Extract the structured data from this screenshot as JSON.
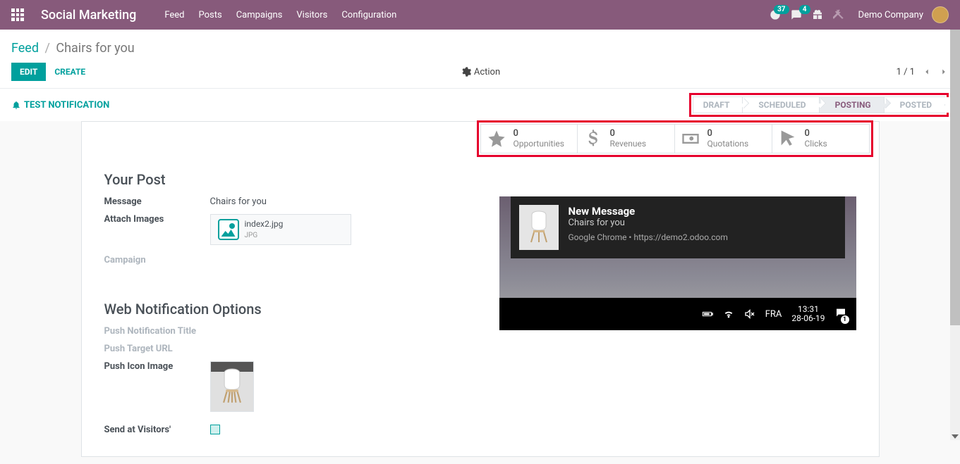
{
  "navbar": {
    "brand": "Social Marketing",
    "items": [
      "Feed",
      "Posts",
      "Campaigns",
      "Visitors",
      "Configuration"
    ],
    "clock_badge": "37",
    "chat_badge": "4",
    "company": "Demo Company"
  },
  "breadcrumb": {
    "parent": "Feed",
    "current": "Chairs for you"
  },
  "buttons": {
    "edit": "Edit",
    "create": "Create",
    "action": "Action",
    "test": "Test Notification"
  },
  "pager": {
    "value": "1 / 1"
  },
  "status": {
    "steps": [
      "Draft",
      "Scheduled",
      "Posting",
      "Posted"
    ],
    "active_index": 2
  },
  "stats": [
    {
      "value": "0",
      "label": "Opportunities"
    },
    {
      "value": "0",
      "label": "Revenues"
    },
    {
      "value": "0",
      "label": "Quotations"
    },
    {
      "value": "0",
      "label": "Clicks"
    }
  ],
  "post": {
    "section": "Your Post",
    "message_label": "Message",
    "message_value": "Chairs for you",
    "attach_label": "Attach Images",
    "attach_name": "index2.jpg",
    "attach_type": "JPG",
    "campaign_label": "Campaign"
  },
  "webnotif": {
    "section": "Web Notification Options",
    "title_label": "Push Notification Title",
    "url_label": "Push Target URL",
    "icon_label": "Push Icon Image",
    "send_label": "Send at Visitors'"
  },
  "preview": {
    "title": "New Message",
    "body": "Chairs for you",
    "meta": "Google Chrome • https://demo2.odoo.com",
    "taskbar": {
      "lang": "FRA",
      "time": "13:31",
      "date": "28-06-19",
      "notif_count": "1"
    }
  }
}
